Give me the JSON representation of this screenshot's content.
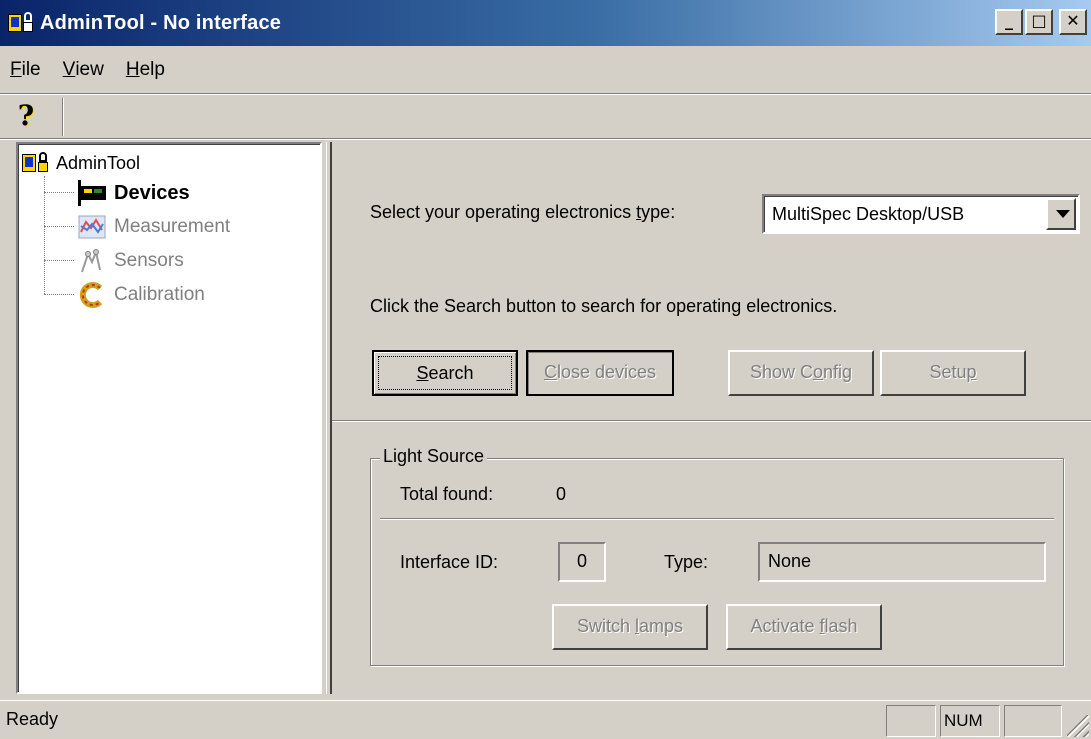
{
  "window": {
    "title": "AdminTool - No interface",
    "buttons": {
      "minimize": "_",
      "maximize": "□",
      "close": "✕"
    }
  },
  "menu": [
    {
      "accel": "F",
      "rest": "ile"
    },
    {
      "accel": "V",
      "rest": "iew"
    },
    {
      "accel": "H",
      "rest": "elp"
    }
  ],
  "toolbar": {
    "help_glyph": "?"
  },
  "tree": {
    "root": "AdminTool",
    "items": [
      {
        "label": "Devices",
        "state": "active"
      },
      {
        "label": "Measurement",
        "state": "disabled"
      },
      {
        "label": "Sensors",
        "state": "disabled"
      },
      {
        "label": "Calibration",
        "state": "disabled"
      }
    ]
  },
  "devices": {
    "select_label_pre": "Select your operating electronics ",
    "select_label_accel": "t",
    "select_label_post": "ype:",
    "electronics_type": "MultiSpec Desktop/USB",
    "hint": "Click the Search button to search for operating electronics.",
    "buttons": {
      "search": {
        "accel": "S",
        "rest": "earch"
      },
      "close_devices": {
        "accel": "C",
        "rest": "lose devices"
      },
      "show_config": {
        "pre": "Show C",
        "accel": "o",
        "rest": "nfig"
      },
      "setup": {
        "pre": "Setu",
        "accel": "p",
        "rest": ""
      }
    }
  },
  "light_source": {
    "title": "Light Source",
    "total_found_label": "Total found:",
    "total_found_value": "0",
    "interface_id_label": "Interface ID:",
    "interface_id_value": "0",
    "type_label": "Type:",
    "type_value": "None",
    "switch_lamps": {
      "pre": "Switch ",
      "accel": "l",
      "rest": "amps"
    },
    "activate_flash": {
      "pre": "Activate ",
      "accel": "f",
      "rest": "lash"
    }
  },
  "status": {
    "text": "Ready",
    "num_indicator": "NUM"
  }
}
